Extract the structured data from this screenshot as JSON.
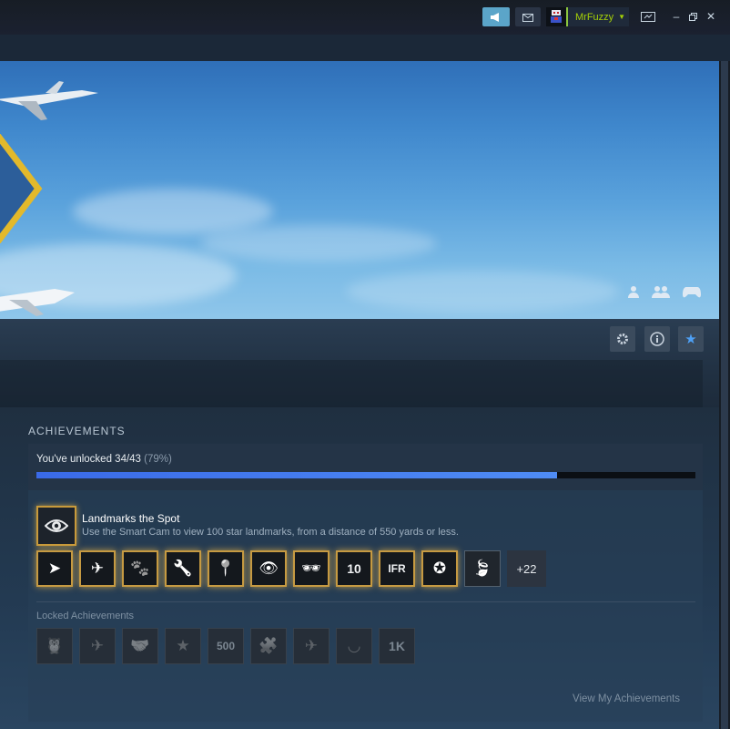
{
  "titlebar": {
    "username": "MrFuzzy",
    "icons": [
      "megaphone-icon",
      "envelope-icon",
      "avatar",
      "chevron-down-icon",
      "screenshot-icon",
      "minimize-icon",
      "restore-icon",
      "close-icon"
    ]
  },
  "hero": {
    "icons": [
      "person-icon",
      "friends-icon",
      "controller-icon"
    ]
  },
  "actions": [
    "gear-icon",
    "info-icon",
    "star-icon"
  ],
  "achievements": {
    "heading": "ACHIEVEMENTS",
    "progress_text": "You've unlocked 34/43",
    "progress_pct": "(79%)",
    "progress_fraction": 0.79,
    "featured": {
      "title": "Landmarks the Spot",
      "description": "Use the Smart Cam to view 100 star landmarks, from a distance of 550 yards or less."
    },
    "unlocked_icons": [
      {
        "name": "paper-plane-icon",
        "glyph": "➤"
      },
      {
        "name": "landing-icon",
        "glyph": "✈"
      },
      {
        "name": "paw-eye-icon",
        "glyph": "🐾"
      },
      {
        "name": "wrench-icon",
        "glyph": "🔧"
      },
      {
        "name": "pin-eye-icon",
        "glyph": "📍"
      },
      {
        "name": "eye-pin-icon",
        "glyph": "👁"
      },
      {
        "name": "sunglasses-icon",
        "glyph": "🕶"
      },
      {
        "name": "calendar-10-icon",
        "text": "10"
      },
      {
        "name": "ifr-icon",
        "text": "IFR"
      },
      {
        "name": "crosshair-star-icon",
        "glyph": "✪"
      },
      {
        "name": "leaf-icon",
        "glyph": "🍃"
      }
    ],
    "more_count": "+22",
    "locked_label": "Locked Achievements",
    "locked_icons": [
      {
        "name": "owl-icon",
        "glyph": "🦉"
      },
      {
        "name": "plane-badge-icon",
        "glyph": "✈"
      },
      {
        "name": "handshake-icon",
        "glyph": "🤝"
      },
      {
        "name": "pilot-hat-icon",
        "glyph": "★"
      },
      {
        "name": "500-badge-icon",
        "text": "500"
      },
      {
        "name": "puzzle-icon",
        "glyph": "🧩"
      },
      {
        "name": "plane-target-icon",
        "glyph": "✈"
      },
      {
        "name": "cap-icon",
        "glyph": "◡"
      },
      {
        "name": "1k-badge-icon",
        "text": "1K"
      }
    ],
    "view_link": "View My Achievements"
  }
}
